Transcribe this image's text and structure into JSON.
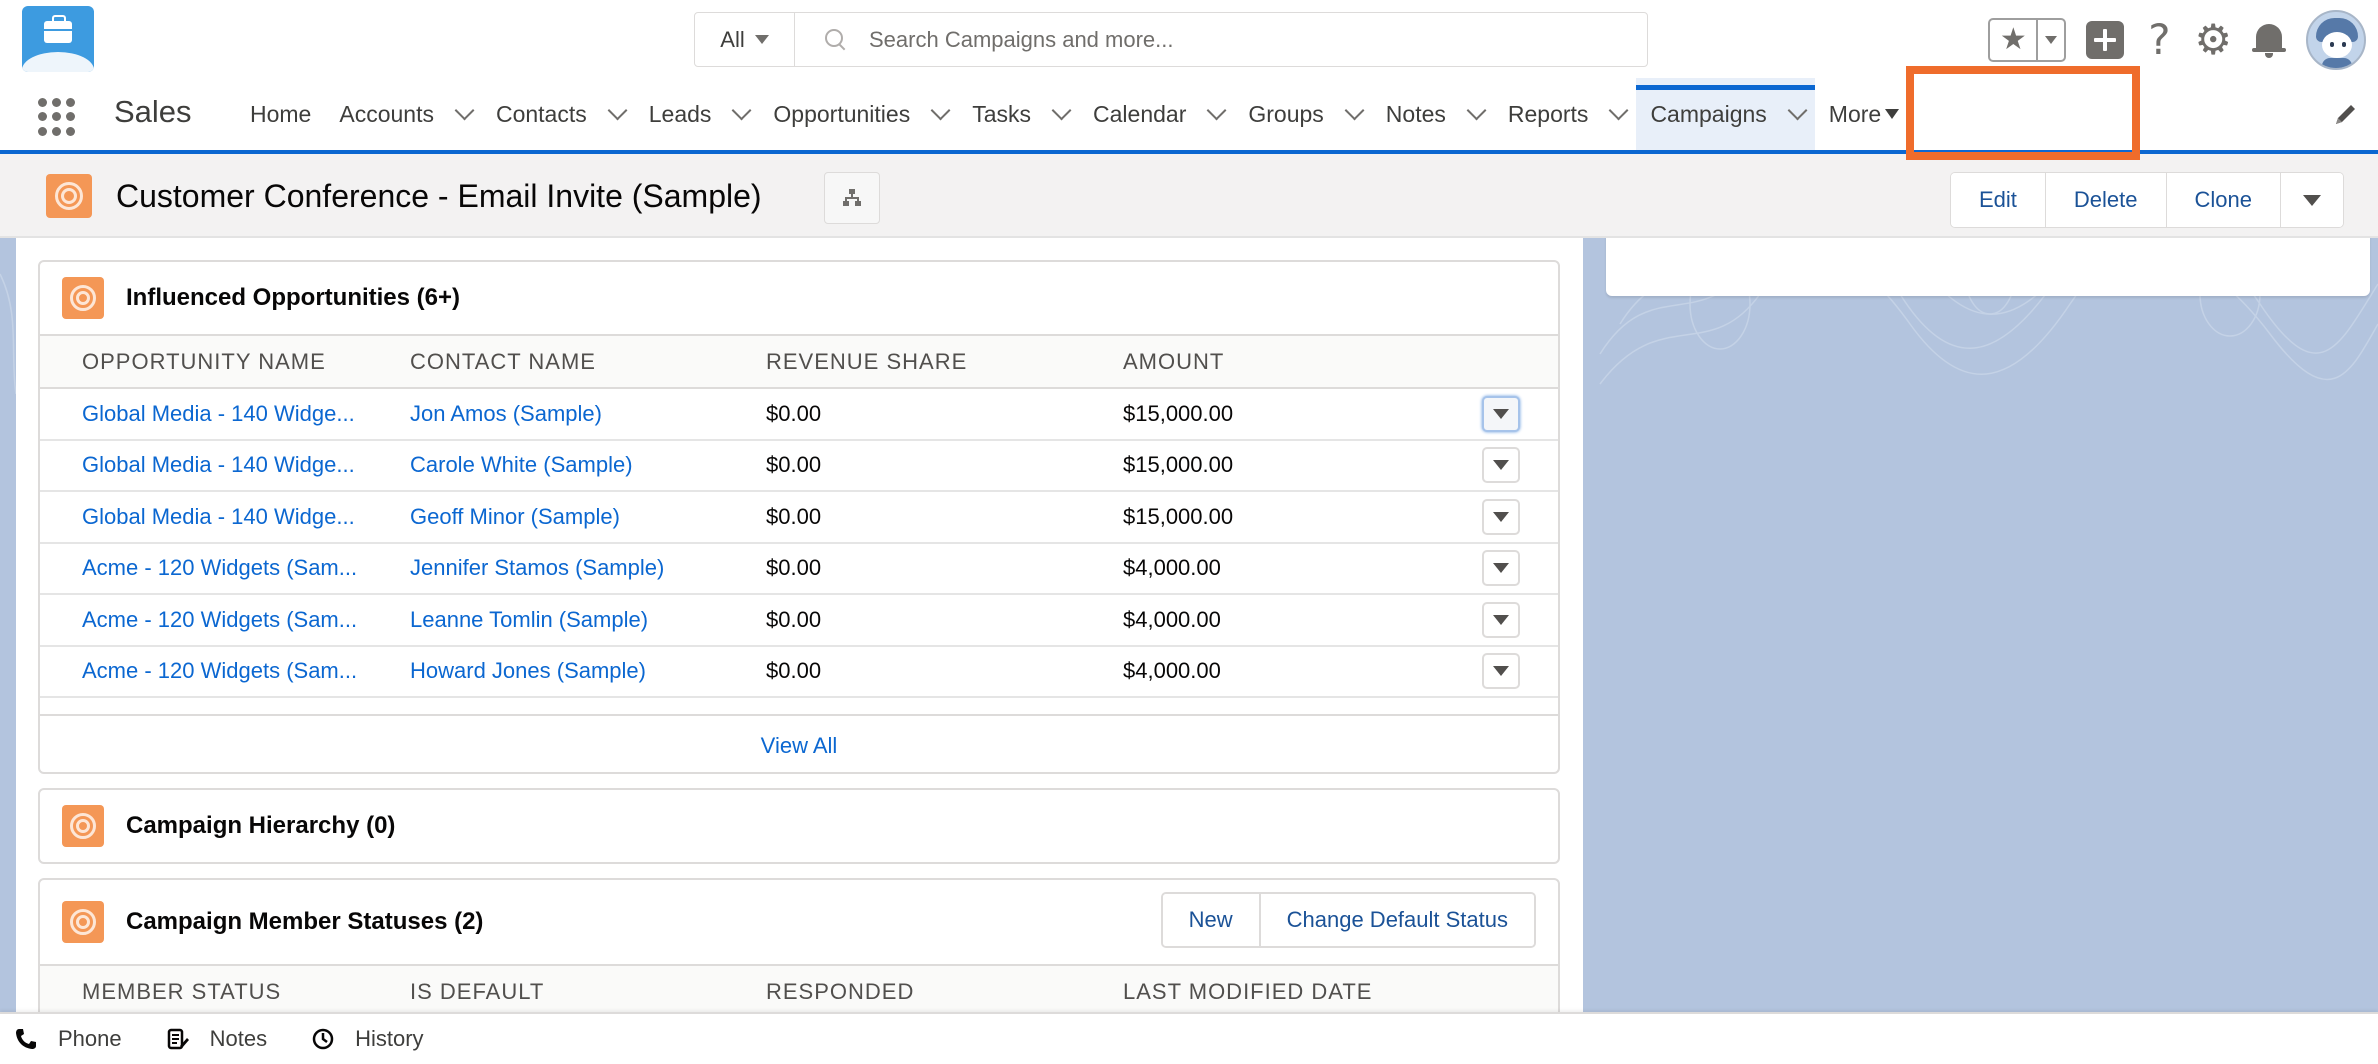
{
  "global_header": {
    "search_scope": "All",
    "search_placeholder": "Search Campaigns and more..."
  },
  "nav": {
    "app_name": "Sales",
    "items": [
      {
        "label": "Home",
        "has_menu": false
      },
      {
        "label": "Accounts",
        "has_menu": true
      },
      {
        "label": "Contacts",
        "has_menu": true
      },
      {
        "label": "Leads",
        "has_menu": true
      },
      {
        "label": "Opportunities",
        "has_menu": true
      },
      {
        "label": "Tasks",
        "has_menu": true
      },
      {
        "label": "Calendar",
        "has_menu": true
      },
      {
        "label": "Groups",
        "has_menu": true
      },
      {
        "label": "Notes",
        "has_menu": true
      },
      {
        "label": "Reports",
        "has_menu": true
      },
      {
        "label": "Campaigns",
        "has_menu": true,
        "active": true
      }
    ],
    "more_label": "More"
  },
  "record": {
    "title": "Customer Conference - Email Invite (Sample)",
    "actions": {
      "edit": "Edit",
      "delete": "Delete",
      "clone": "Clone"
    }
  },
  "influenced_opportunities": {
    "title": "Influenced Opportunities (6+)",
    "columns": [
      "OPPORTUNITY NAME",
      "CONTACT NAME",
      "REVENUE SHARE",
      "AMOUNT"
    ],
    "rows": [
      {
        "opportunity": "Global Media - 140 Widge...",
        "contact": "Jon Amos (Sample)",
        "revenue_share": "$0.00",
        "amount": "$15,000.00"
      },
      {
        "opportunity": "Global Media - 140 Widge...",
        "contact": "Carole White (Sample)",
        "revenue_share": "$0.00",
        "amount": "$15,000.00"
      },
      {
        "opportunity": "Global Media - 140 Widge...",
        "contact": "Geoff Minor (Sample)",
        "revenue_share": "$0.00",
        "amount": "$15,000.00"
      },
      {
        "opportunity": "Acme - 120 Widgets (Sam...",
        "contact": "Jennifer Stamos (Sample)",
        "revenue_share": "$0.00",
        "amount": "$4,000.00"
      },
      {
        "opportunity": "Acme - 120 Widgets (Sam...",
        "contact": "Leanne Tomlin (Sample)",
        "revenue_share": "$0.00",
        "amount": "$4,000.00"
      },
      {
        "opportunity": "Acme - 120 Widgets (Sam...",
        "contact": "Howard Jones (Sample)",
        "revenue_share": "$0.00",
        "amount": "$4,000.00"
      }
    ],
    "view_all": "View All"
  },
  "campaign_hierarchy": {
    "title": "Campaign Hierarchy (0)"
  },
  "member_statuses": {
    "title": "Campaign Member Statuses (2)",
    "new_label": "New",
    "change_default_label": "Change Default Status",
    "columns": [
      "MEMBER STATUS",
      "IS DEFAULT",
      "RESPONDED",
      "LAST MODIFIED DATE"
    ]
  },
  "utility_bar": {
    "items": [
      {
        "label": "Phone",
        "icon": "phone-icon"
      },
      {
        "label": "Notes",
        "icon": "notes-icon"
      },
      {
        "label": "History",
        "icon": "clock-icon"
      }
    ]
  },
  "colors": {
    "brand_blue": "#0b67d1",
    "campaign_orange": "#f49756",
    "highlight_orange": "#ef6c2b",
    "page_background": "#b3c4de"
  }
}
